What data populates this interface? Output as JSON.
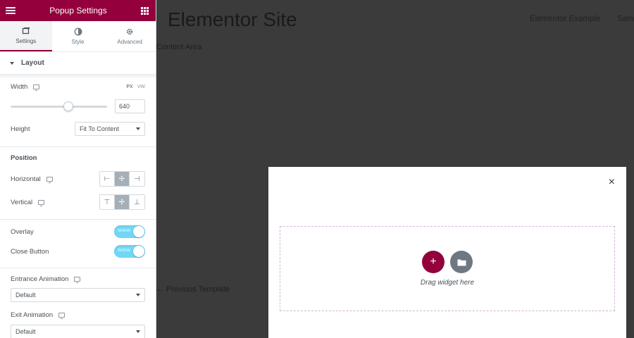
{
  "sidebar": {
    "header": {
      "title": "Popup Settings"
    },
    "tabs": [
      {
        "label": "Settings",
        "icon": "settings-icon"
      },
      {
        "label": "Style",
        "icon": "style-half-circle-icon"
      },
      {
        "label": "Advanced",
        "icon": "gear-icon"
      }
    ],
    "layout": {
      "section_title": "Layout",
      "width_label": "Width",
      "width_units": [
        "PX",
        "VW"
      ],
      "width_value": "640",
      "width_slider_percent": 60,
      "height_label": "Height",
      "height_value": "Fit To Content"
    },
    "position": {
      "title": "Position",
      "horizontal_label": "Horizontal",
      "vertical_label": "Vertical"
    },
    "overlay": {
      "label": "Overlay",
      "state": "SHOW"
    },
    "close_button": {
      "label": "Close Button",
      "state": "SHOW"
    },
    "entrance": {
      "label": "Entrance Animation",
      "value": "Default"
    },
    "exit": {
      "label": "Exit Animation",
      "value": "Default"
    }
  },
  "canvas": {
    "site_title": "Elementor Site",
    "nav": [
      "Elementor Example",
      "Sam"
    ],
    "content_area": "Content Area",
    "prev_link": "← Previous Template",
    "popup": {
      "close": "×",
      "drop_text": "Drag widget here",
      "add_symbol": "+"
    }
  },
  "colors": {
    "brand": "#93003c",
    "switch_on": "#71d7f7",
    "canvas_bg": "#3b3b3b"
  }
}
